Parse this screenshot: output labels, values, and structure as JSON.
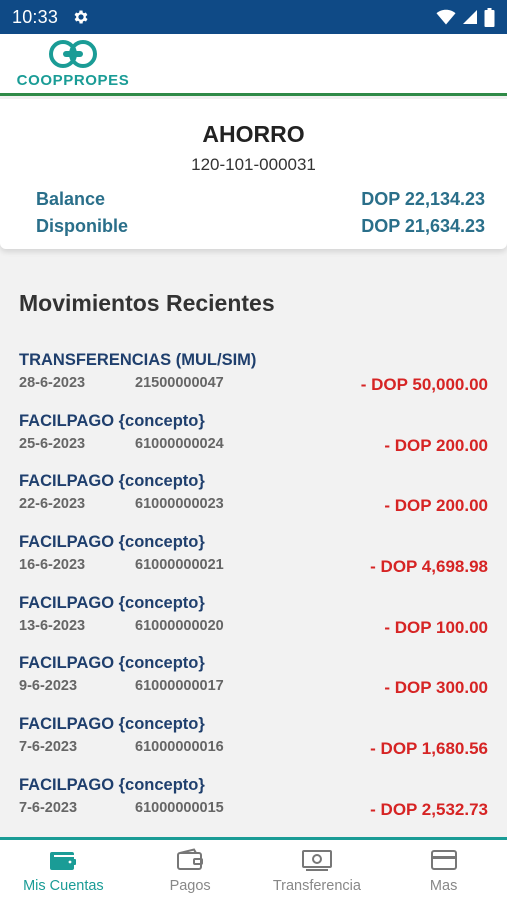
{
  "status_bar": {
    "time": "10:33"
  },
  "header": {
    "logo_text": "COOPPROPES"
  },
  "account": {
    "type": "AHORRO",
    "number": "120-101-000031",
    "balance_label": "Balance",
    "balance_value": "DOP 22,134.23",
    "available_label": "Disponible",
    "available_value": "DOP 21,634.23"
  },
  "movements": {
    "title": "Movimientos Recientes",
    "items": [
      {
        "title": "TRANSFERENCIAS (MUL/SIM)",
        "date": "28-6-2023",
        "ref": "21500000047",
        "amount": "- DOP 50,000.00"
      },
      {
        "title": "FACILPAGO {concepto}",
        "date": "25-6-2023",
        "ref": "61000000024",
        "amount": "- DOP 200.00"
      },
      {
        "title": "FACILPAGO {concepto}",
        "date": "22-6-2023",
        "ref": "61000000023",
        "amount": "- DOP 200.00"
      },
      {
        "title": "FACILPAGO {concepto}",
        "date": "16-6-2023",
        "ref": "61000000021",
        "amount": "- DOP 4,698.98"
      },
      {
        "title": "FACILPAGO {concepto}",
        "date": "13-6-2023",
        "ref": "61000000020",
        "amount": "- DOP 100.00"
      },
      {
        "title": "FACILPAGO {concepto}",
        "date": "9-6-2023",
        "ref": "61000000017",
        "amount": "- DOP 300.00"
      },
      {
        "title": "FACILPAGO {concepto}",
        "date": "7-6-2023",
        "ref": "61000000016",
        "amount": "- DOP 1,680.56"
      },
      {
        "title": "FACILPAGO {concepto}",
        "date": "7-6-2023",
        "ref": "61000000015",
        "amount": "- DOP 2,532.73"
      }
    ]
  },
  "bottom_nav": {
    "items": [
      {
        "label": "Mis Cuentas",
        "icon": "wallet-icon",
        "active": true
      },
      {
        "label": "Pagos",
        "icon": "wallet-outline-icon",
        "active": false
      },
      {
        "label": "Transferencia",
        "icon": "money-icon",
        "active": false
      },
      {
        "label": "Mas",
        "icon": "card-icon",
        "active": false
      }
    ]
  },
  "colors": {
    "status_bar": "#0f4a86",
    "brand_teal": "#1a9c96",
    "header_rule": "#2f8a47",
    "account_labels": "#2a6f8a",
    "tx_title": "#1f3f6d",
    "amount_negative": "#d62424"
  }
}
